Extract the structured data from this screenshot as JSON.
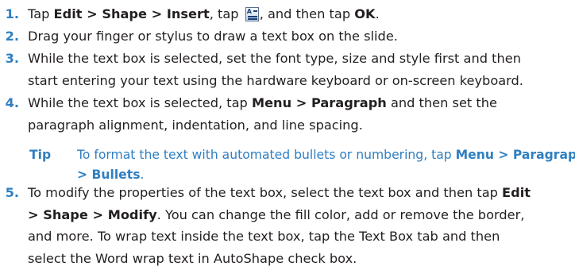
{
  "steps": [
    {
      "number": "1.",
      "parts": {
        "a": "Tap ",
        "b": "Edit > Shape > Insert",
        "c": ", tap ",
        "d": ", and then tap ",
        "e": "OK",
        "f": "."
      },
      "icon": "insert-text-box-icon"
    },
    {
      "number": "2.",
      "lines": [
        "Drag your finger or stylus to draw a text box on the slide."
      ]
    },
    {
      "number": "3.",
      "lines": [
        "While the text box is selected, set the font type, size and style first and then",
        "start entering your text using the hardware keyboard or on-screen keyboard."
      ]
    },
    {
      "number": "4.",
      "parts": {
        "a": "While the text box is selected, tap ",
        "b": "Menu > Paragraph",
        "c": " and then set the",
        "line2": "paragraph alignment, indentation, and line spacing."
      }
    },
    {
      "number": "5.",
      "parts": {
        "a": "To modify the properties of the text box, select the text box and then tap ",
        "b": "Edit",
        "c": "> Shape > Modify",
        "d": ". You can change the fill color, add or remove the border,",
        "line3": "and more. To wrap text inside the text box, tap the Text Box tab and then",
        "line4": "select the Word wrap text in AutoShape check box."
      }
    }
  ],
  "tip": {
    "label": "Tip",
    "a": "To format the text with automated bullets or numbering, tap ",
    "b": "Menu > Paragraph",
    "c": "> Bullets",
    "d": "."
  },
  "colors": {
    "accent": "#2f7fc1",
    "text": "#231f20"
  }
}
